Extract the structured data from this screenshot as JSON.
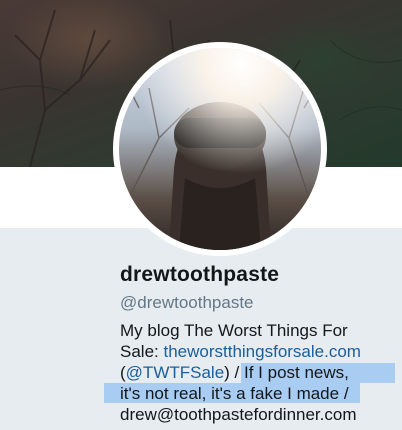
{
  "profile": {
    "display_name": "drewtoothpaste",
    "handle": "@drewtoothpaste"
  },
  "bio": {
    "line1": "My blog The Worst Things For",
    "line2_prefix": "Sale: ",
    "line2_link": "theworstthingsforsale.com",
    "line3_open": "(",
    "line3_link": "@TWTFSale",
    "line3_mid": ") / ",
    "line3_selected": "If I post news,",
    "line4_selected": "it's not real, it's a fake I made",
    "line4_suffix": " /",
    "line5": "drew@toothpastefordinner.com"
  },
  "colors": {
    "page_background": "#e6ecf0",
    "link": "#1b5e99",
    "selection": "#a9cdf2",
    "handle": "#657786"
  },
  "icons": {
    "avatar": "profile-photo",
    "banner": "header-photo"
  }
}
